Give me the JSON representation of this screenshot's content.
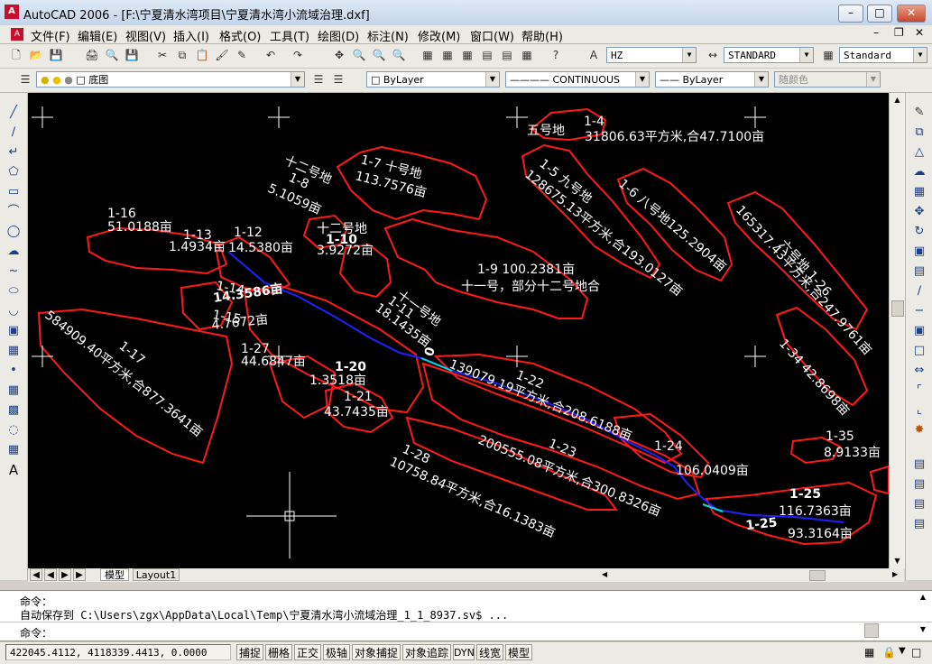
{
  "window": {
    "title": "AutoCAD 2006 - [F:\\宁夏清水湾项目\\宁夏清水湾小流域治理.dxf]",
    "logo": "A"
  },
  "menus": [
    "文件(F)",
    "编辑(E)",
    "视图(V)",
    "插入(I)",
    "格式(O)",
    "工具(T)",
    "绘图(D)",
    "标注(N)",
    "修改(M)",
    "窗口(W)",
    "帮助(H)"
  ],
  "styles": {
    "text_style": "HZ",
    "dim_style": "STANDARD",
    "table_style": "Standard"
  },
  "layers": {
    "current_layer": "底图",
    "color": "ByLayer",
    "linetype": "CONTINUOUS",
    "lineweight": "ByLayer",
    "plotstyle": "随颜色"
  },
  "drawing_labels": [
    {
      "id": "l1",
      "text": "五号地"
    },
    {
      "id": "l2",
      "text": "1-4"
    },
    {
      "id": "l3",
      "text": "31806.63平方米,合47.7100亩"
    },
    {
      "id": "l4",
      "text": "十二号地"
    },
    {
      "id": "l5",
      "text": "1-8"
    },
    {
      "id": "l6",
      "text": "5.1059亩"
    },
    {
      "id": "l7",
      "text": "1-7  十号地"
    },
    {
      "id": "l8",
      "text": "113.7576亩"
    },
    {
      "id": "l9",
      "text": "1-5 九号地"
    },
    {
      "id": "l10",
      "text": "128675.13平方米,合193.0127亩"
    },
    {
      "id": "l11",
      "text": "1-6 八号地125.2904亩"
    },
    {
      "id": "l12",
      "text": "165317.43平方米,合247.9761亩"
    },
    {
      "id": "l13",
      "text": "六号地 1-26"
    },
    {
      "id": "l14",
      "text": "1-16"
    },
    {
      "id": "l15",
      "text": "51.0188亩"
    },
    {
      "id": "l16",
      "text": "1-13"
    },
    {
      "id": "l17",
      "text": "1.4934亩"
    },
    {
      "id": "l18",
      "text": "1-12"
    },
    {
      "id": "l19",
      "text": "14.5380亩"
    },
    {
      "id": "l20",
      "text": "十二号地"
    },
    {
      "id": "l21",
      "text": "1-10"
    },
    {
      "id": "l22",
      "text": "3.9272亩"
    },
    {
      "id": "l23",
      "text": "1-9  100.2381亩"
    },
    {
      "id": "l24",
      "text": "十一号，部分十二号地合"
    },
    {
      "id": "l25",
      "text": "1-14"
    },
    {
      "id": "l26",
      "text": "14.3586亩"
    },
    {
      "id": "l27",
      "text": "1-15"
    },
    {
      "id": "l28",
      "text": "4.7672亩"
    },
    {
      "id": "l29",
      "text": "十一号地"
    },
    {
      "id": "l30",
      "text": "1-11"
    },
    {
      "id": "l31",
      "text": "18.1435亩"
    },
    {
      "id": "l32",
      "text": "584909.40平方米,合877.3641亩"
    },
    {
      "id": "l33",
      "text": "1-17"
    },
    {
      "id": "l34",
      "text": "1-27"
    },
    {
      "id": "l35",
      "text": "44.6847亩"
    },
    {
      "id": "l36",
      "text": "1-20"
    },
    {
      "id": "l37",
      "text": "1.3518亩"
    },
    {
      "id": "l38",
      "text": "1-21"
    },
    {
      "id": "l39",
      "text": "43.7435亩"
    },
    {
      "id": "l40",
      "text": "1-22"
    },
    {
      "id": "l41",
      "text": "139079.19平方米,合208.6188亩"
    },
    {
      "id": "l42",
      "text": "1-34  42.8698亩"
    },
    {
      "id": "l43",
      "text": "1-28"
    },
    {
      "id": "l44",
      "text": "10758.84平方米,合16.1383亩"
    },
    {
      "id": "l45",
      "text": "1-23"
    },
    {
      "id": "l46",
      "text": "200555.08平方米,合300.8326亩"
    },
    {
      "id": "l47",
      "text": "1-24"
    },
    {
      "id": "l48",
      "text": "106.0409亩"
    },
    {
      "id": "l49",
      "text": "1-35"
    },
    {
      "id": "l50",
      "text": "8.9133亩"
    },
    {
      "id": "l51",
      "text": "1-25"
    },
    {
      "id": "l52",
      "text": "116.7363亩"
    },
    {
      "id": "l53",
      "text": "1-25"
    },
    {
      "id": "l54",
      "text": "93.3164亩"
    },
    {
      "id": "l55",
      "text": "0"
    }
  ],
  "layout_tabs": {
    "model": "模型",
    "layout1": "Layout1"
  },
  "command": {
    "line1": "命令：",
    "line2": "自动保存到 C:\\Users\\zgx\\AppData\\Local\\Temp\\宁夏清水湾小流域治理_1_1_8937.sv$ ...",
    "prompt": "命令："
  },
  "status": {
    "coords": "422045.4112, 4118339.4413, 0.0000",
    "buttons": [
      "捕捉",
      "栅格",
      "正交",
      "极轴",
      "对象捕捉",
      "对象追踪",
      "DYN",
      "线宽",
      "模型"
    ]
  },
  "colors": {
    "boundary": "#ff1a1a",
    "channel": "#2020ff",
    "canvas": "#000000"
  }
}
